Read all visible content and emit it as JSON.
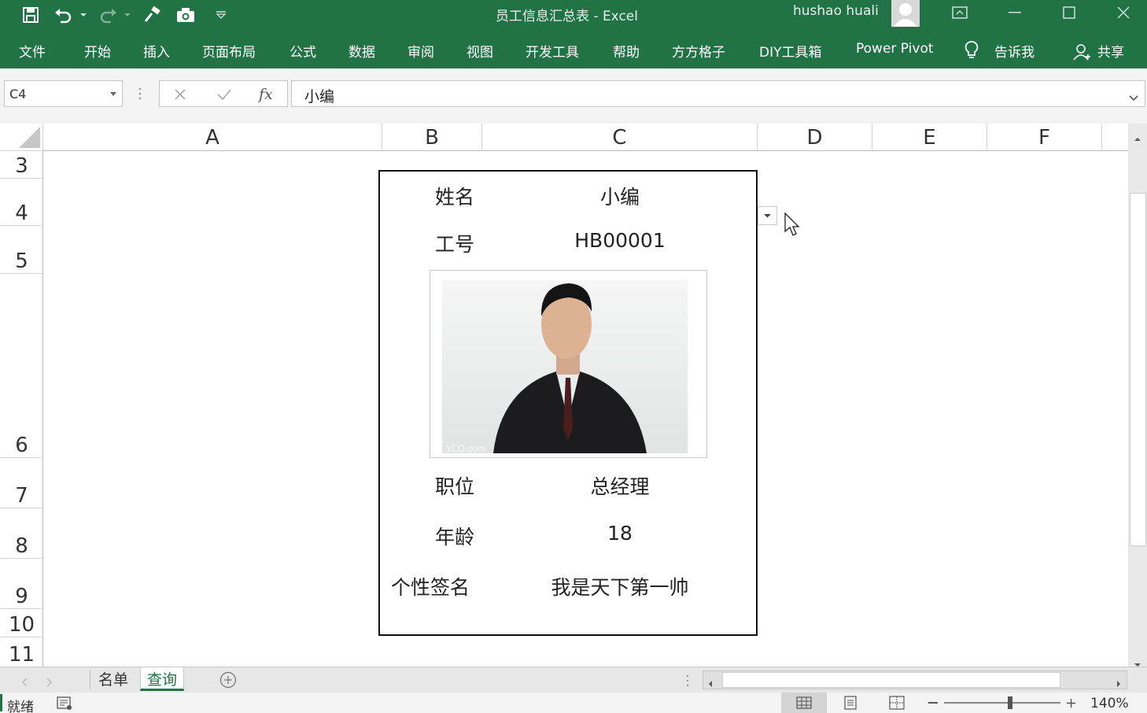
{
  "titlebar": {
    "title": "员工信息汇总表  -  Excel",
    "user": "hushao huali"
  },
  "ribbon": {
    "tabs": [
      "文件",
      "开始",
      "插入",
      "页面布局",
      "公式",
      "数据",
      "审阅",
      "视图",
      "开发工具",
      "帮助",
      "方方格子",
      "DIY工具箱",
      "Power Pivot",
      "告诉我",
      "共享"
    ]
  },
  "formula_bar": {
    "name_box": "C4",
    "fx_label": "fx",
    "content": "小编"
  },
  "columns": [
    "A",
    "B",
    "C",
    "D",
    "E",
    "F"
  ],
  "rows": [
    "3",
    "4",
    "5",
    "6",
    "7",
    "8",
    "9",
    "10",
    "11"
  ],
  "card": {
    "name_label": "姓名",
    "name_value": "小编",
    "id_label": "工号",
    "id_value": "HB00001",
    "photo_watermark": "YLQ.com",
    "position_label": "职位",
    "position_value": "总经理",
    "age_label": "年龄",
    "age_value": "18",
    "signature_label": "个性签名",
    "signature_value": "我是天下第一帅"
  },
  "sheet_tabs": [
    "名单",
    "查询"
  ],
  "active_sheet": "查询",
  "status": {
    "ready": "就绪",
    "zoom": "140%",
    "zoom_level_percent": 140
  },
  "colors": {
    "excel_green": "#217346",
    "header_border": "#d4d4d4"
  }
}
